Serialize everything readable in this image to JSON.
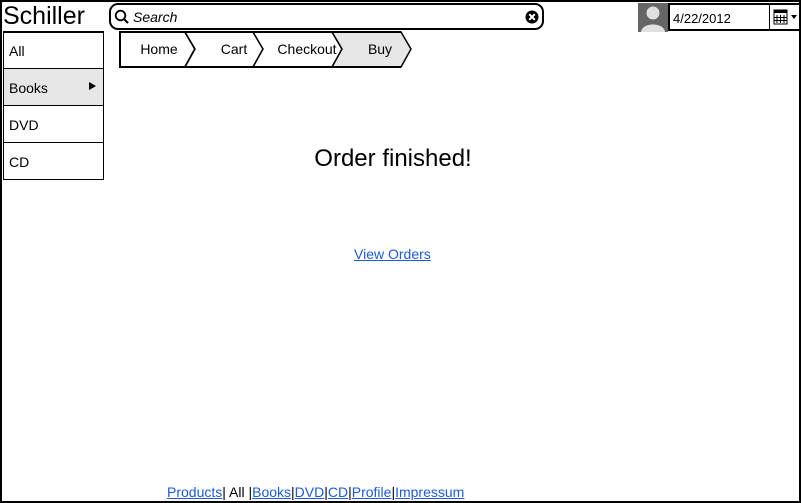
{
  "app": {
    "logo": "Schiller"
  },
  "search": {
    "placeholder": "Search",
    "value": "",
    "icon": "search-icon",
    "clear_icon": "close-icon"
  },
  "user": {
    "avatar_icon": "user-icon"
  },
  "date_picker": {
    "value": "4/22/2012",
    "icon": "calendar-icon"
  },
  "sidebar": {
    "items": [
      {
        "label": "All",
        "active": false
      },
      {
        "label": "Books",
        "active": true,
        "has_submenu": true
      },
      {
        "label": "DVD",
        "active": false
      },
      {
        "label": "CD",
        "active": false
      }
    ]
  },
  "breadcrumb": {
    "steps": [
      {
        "label": "Home",
        "active": false
      },
      {
        "label": "Cart",
        "active": false
      },
      {
        "label": "Checkout",
        "active": false
      },
      {
        "label": "Buy",
        "active": true
      }
    ]
  },
  "main": {
    "title": "Order finished!",
    "view_orders_link": "View Orders"
  },
  "footer": {
    "links": [
      "Products",
      "All",
      "Books",
      "DVD",
      "CD",
      "Profile",
      "Impressum"
    ],
    "separator": "|"
  },
  "colors": {
    "link": "#1d5bd6",
    "active_bg": "#e6e6e6",
    "avatar_bg": "#666666"
  }
}
